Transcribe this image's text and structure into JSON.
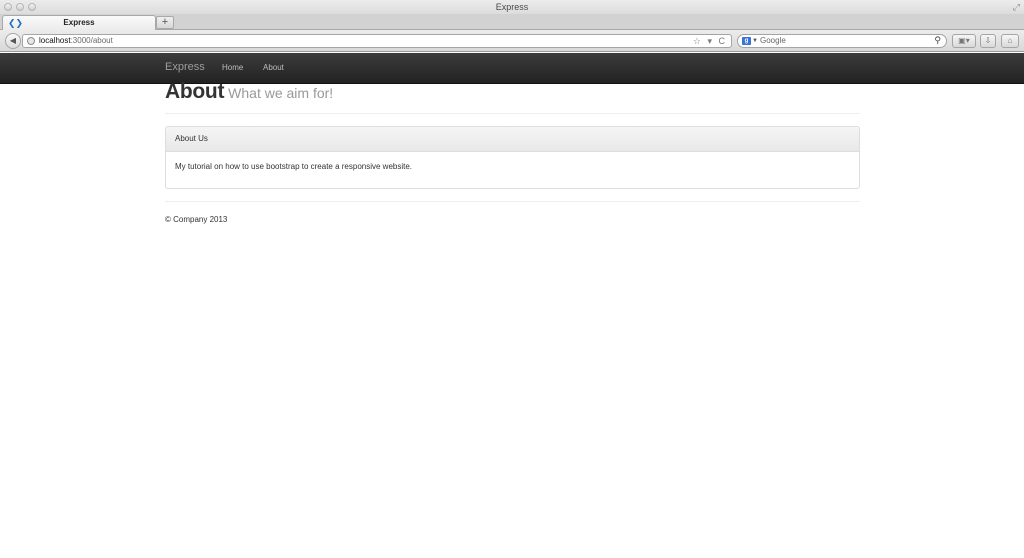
{
  "window": {
    "title": "Express"
  },
  "tabs": [
    {
      "title": "Express"
    }
  ],
  "toolbar": {
    "new_tab_label": "+",
    "back_glyph": "◀",
    "url_host": "localhost",
    "url_path": ":3000/about",
    "url_icons": "☆ ▾ C",
    "search_placeholder": "Google",
    "search_engine_glyph": "g",
    "search_glyph": "⚲",
    "bookmarks_glyph": "▣▾",
    "download_glyph": "⇩",
    "home_glyph": "⌂"
  },
  "site_nav": {
    "brand": "Express",
    "links": [
      "Home",
      "About"
    ]
  },
  "header": {
    "title": "About",
    "subtitle": "What we aim for!"
  },
  "panel": {
    "heading": "About Us",
    "body": "My tutorial on how to use bootstrap to create a responsive website."
  },
  "footer": {
    "text": "© Company 2013"
  },
  "colors": {
    "navbar_bg": "#222222",
    "brand_text": "#9d9d9d",
    "subtitle_text": "#999999",
    "panel_border": "#dddddd"
  }
}
